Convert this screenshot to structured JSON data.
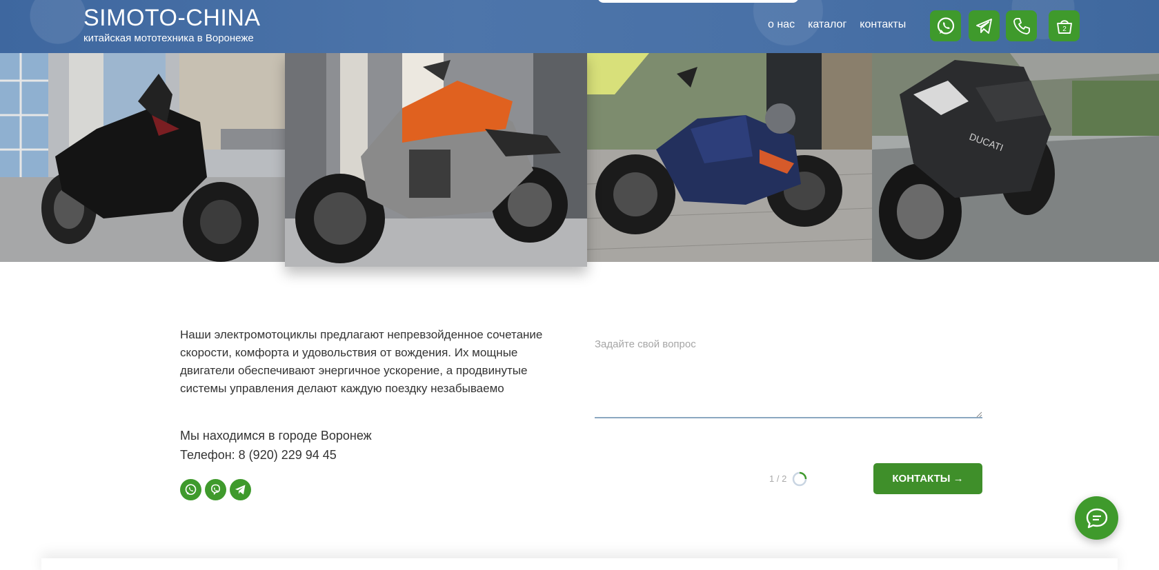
{
  "header": {
    "brand_title": "SIMOTO-CHINA",
    "brand_subtitle": "китайская мототехника в Воронеже",
    "nav": [
      "о нас",
      "каталог",
      "контакты"
    ],
    "cart_count": "2",
    "icons": [
      "whatsapp-icon",
      "telegram-icon",
      "phone-icon",
      "cart-icon"
    ]
  },
  "gallery": {
    "photos": [
      "black-naked-motorcycle",
      "orange-gray-motorcycle",
      "blue-motorcycle",
      "dark-sport-motorcycle"
    ],
    "active_index": 1
  },
  "content": {
    "description": "Наши электромотоциклы предлагают непревзойденное сочетание скорости, комфорта и удовольствия от вождения. Их мощные двигатели обеспечивают энергичное ускорение, а продвинутые системы управления делают каждую поездку незабываемо",
    "location": "Мы находимся в городе Воронеж",
    "phone": "Телефон: 8 (920) 229 94 45",
    "social_icons": [
      "whatsapp-icon",
      "viber-icon",
      "telegram-icon"
    ]
  },
  "form": {
    "question_placeholder": "Задайте свой вопрос",
    "question_value": "",
    "step_counter": "1 / 2",
    "contacts_button": "КОНТАКТЫ →"
  },
  "colors": {
    "header": "#4870a6",
    "accent_green": "#3f9a2c",
    "button_green": "#3f8f2a"
  }
}
